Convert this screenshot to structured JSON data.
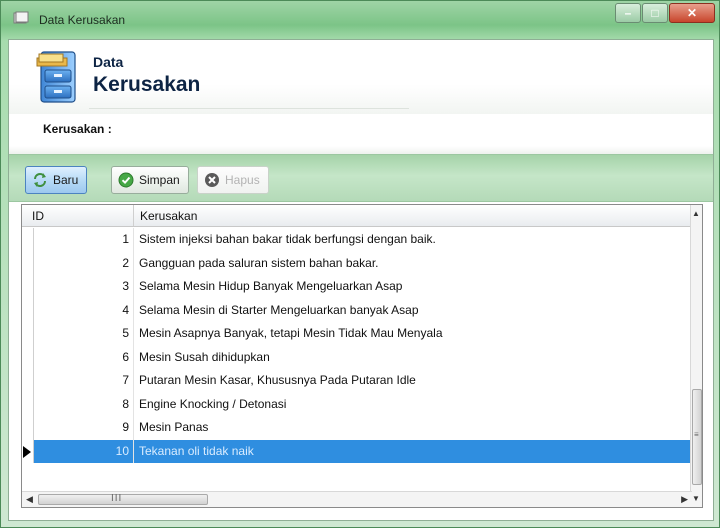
{
  "window": {
    "title": "Data Kerusakan",
    "buttons": {
      "minimize": "–",
      "maximize": "□",
      "close": "✕"
    }
  },
  "header": {
    "title_small": "Data",
    "title_big": "Kerusakan",
    "icon": "file-cabinet-icon"
  },
  "form": {
    "label": "Kerusakan :",
    "value": ""
  },
  "toolbar": {
    "new_label": "Baru",
    "save_label": "Simpan",
    "delete_label": "Hapus"
  },
  "grid": {
    "columns": [
      "ID",
      "Kerusakan"
    ],
    "rows": [
      {
        "id": "1",
        "kerusakan": "Sistem injeksi bahan bakar tidak berfungsi dengan baik."
      },
      {
        "id": "2",
        "kerusakan": "Gangguan pada saluran sistem bahan bakar."
      },
      {
        "id": "3",
        "kerusakan": "Selama Mesin Hidup Banyak Mengeluarkan Asap"
      },
      {
        "id": "4",
        "kerusakan": "Selama Mesin di Starter Mengeluarkan banyak Asap"
      },
      {
        "id": "5",
        "kerusakan": "Mesin Asapnya Banyak, tetapi Mesin Tidak Mau Menyala"
      },
      {
        "id": "6",
        "kerusakan": "Mesin Susah dihidupkan"
      },
      {
        "id": "7",
        "kerusakan": "Putaran Mesin Kasar, Khususnya Pada Putaran Idle"
      },
      {
        "id": "8",
        "kerusakan": "Engine Knocking / Detonasi"
      },
      {
        "id": "9",
        "kerusakan": "Mesin Panas"
      },
      {
        "id": "10",
        "kerusakan": "Tekanan oli tidak naik"
      }
    ],
    "selected_row": "10",
    "hscroll_grip": "III",
    "vscroll_grip": "≡"
  },
  "colors": {
    "accent_green": "#a5d3a9",
    "selection_blue": "#2f8ee0",
    "title_navy": "#0d2444"
  }
}
